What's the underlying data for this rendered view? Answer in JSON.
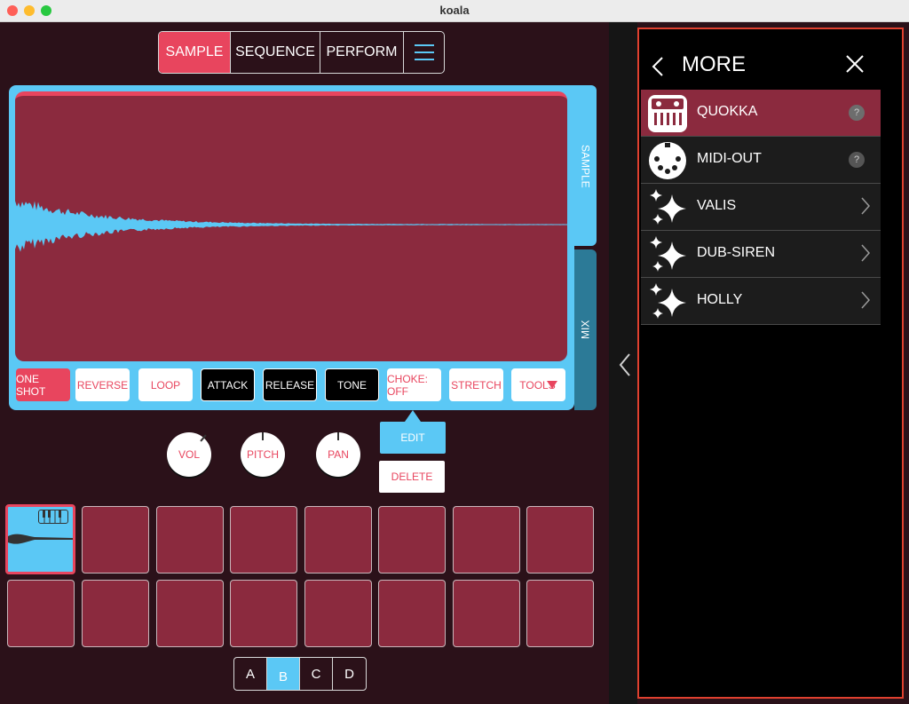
{
  "window": {
    "title": "koala"
  },
  "tabs": [
    {
      "label": "SAMPLE",
      "active": true
    },
    {
      "label": "SEQUENCE",
      "active": false
    },
    {
      "label": "PERFORM",
      "active": false
    }
  ],
  "menu_icon": "hamburger-icon",
  "panel": {
    "side_tabs": {
      "sample": "SAMPLE",
      "mix": "MIX"
    },
    "controls": {
      "one_shot": "ONE SHOT",
      "reverse": "REVERSE",
      "loop": "LOOP",
      "attack": "ATTACK",
      "release": "RELEASE",
      "tone": "TONE",
      "choke": "CHOKE: OFF",
      "stretch": "STRETCH",
      "tools": "TOOLS"
    }
  },
  "knobs": {
    "vol": "VOL",
    "pitch": "PITCH",
    "pan": "PAN"
  },
  "actions": {
    "edit": "EDIT",
    "delete": "DELETE"
  },
  "banks": [
    "A",
    "B",
    "C",
    "D"
  ],
  "active_bank": "B",
  "colors": {
    "accent_red": "#e8455e",
    "accent_blue": "#5bc8f5",
    "pad": "#8b2a3e",
    "background": "#2b1119"
  },
  "more": {
    "title": "MORE",
    "items": [
      {
        "label": "QUOKKA",
        "icon": "piano-icon",
        "help": "?"
      },
      {
        "label": "MIDI-OUT",
        "icon": "midi-plug-icon",
        "help": "?"
      },
      {
        "label": "VALIS",
        "icon": "sparkle-icon"
      },
      {
        "label": "DUB-SIREN",
        "icon": "sparkle-icon"
      },
      {
        "label": "HOLLY",
        "icon": "sparkle-icon"
      }
    ]
  }
}
